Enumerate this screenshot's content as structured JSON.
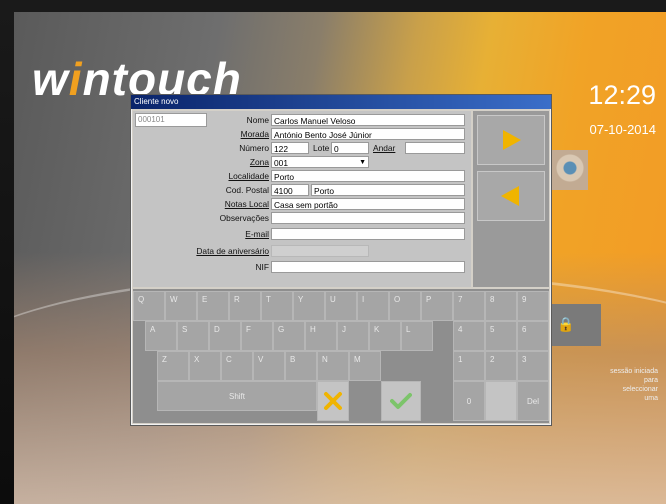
{
  "background": {
    "logo_prefix": "w",
    "logo_accent": "i",
    "logo_suffix": "ntouch",
    "clock": "12:29",
    "date": "07-10-2014",
    "right_text": [
      "sessão iniciada",
      "para",
      "seleccionar",
      "uma"
    ]
  },
  "dialog": {
    "title": "Cliente novo",
    "code": "000101",
    "fields": {
      "nome_label": "Nome",
      "nome_value": "Carlos Manuel Veloso",
      "morada_label": "Morada",
      "morada_value": "António Bento José Júnior",
      "numero_label": "Número",
      "numero_value": "122",
      "lote_label": "Lote",
      "lote_value": "0",
      "andar_label": "Andar",
      "andar_value": "",
      "zona_label": "Zona",
      "zona_value": "001",
      "localidade_label": "Localidade",
      "localidade_value": "Porto",
      "codpostal_label": "Cod. Postal",
      "codpostal_value": "4100",
      "codpostal_city": "Porto",
      "notas_label": "Notas Local",
      "notas_value": "Casa sem portão",
      "observacoes_label": "Observações",
      "observacoes_value": "",
      "email_label": "E-mail",
      "email_value": "",
      "aniversario_label": "Data de aniversário",
      "aniversario_value": "",
      "nif_label": "NIF",
      "nif_value": ""
    }
  },
  "keyboard": {
    "row1": [
      "Q",
      "W",
      "E",
      "R",
      "T",
      "Y",
      "U",
      "I",
      "O",
      "P"
    ],
    "row2": [
      "A",
      "S",
      "D",
      "F",
      "G",
      "H",
      "J",
      "K",
      "L"
    ],
    "row3": [
      "Z",
      "X",
      "C",
      "V",
      "B",
      "N",
      "M"
    ],
    "shift": "Shift",
    "numpad": [
      "7",
      "8",
      "9",
      "4",
      "5",
      "6",
      "1",
      "2",
      "3",
      "0",
      "",
      "Del"
    ]
  },
  "colors": {
    "accent": "#f0b400",
    "confirm": "#7cc46a",
    "titlebar": "#0a246a"
  },
  "icons": {
    "next": "arrow-right-icon",
    "prev": "arrow-left-icon",
    "cancel": "x-icon",
    "confirm": "checkmark-icon"
  }
}
